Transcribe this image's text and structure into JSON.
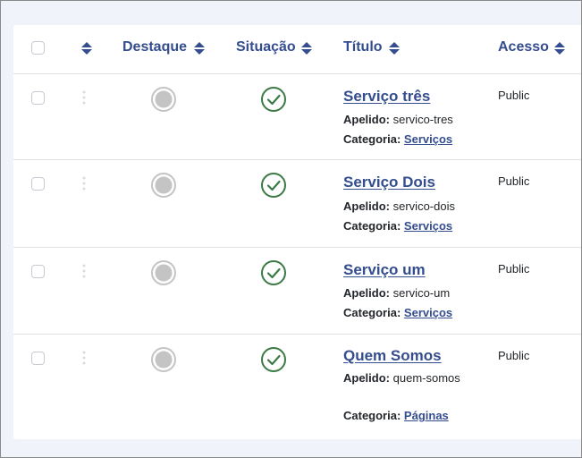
{
  "header": {
    "featured": "Destaque",
    "status": "Situação",
    "title": "Título",
    "access": "Acesso"
  },
  "labels": {
    "alias": "Apelido:",
    "category": "Categoria:"
  },
  "rows": [
    {
      "title": "Serviço três",
      "alias": "servico-tres",
      "category": "Serviços",
      "access": "Public"
    },
    {
      "title": "Serviço Dois",
      "alias": "servico-dois",
      "category": "Serviços",
      "access": "Public"
    },
    {
      "title": "Serviço um",
      "alias": "servico-um",
      "category": "Serviços",
      "access": "Public"
    },
    {
      "title": "Quem Somos",
      "alias": "quem-somos",
      "category": "Páginas",
      "access": "Public"
    }
  ],
  "colors": {
    "accent": "#344d8f",
    "published": "#3b7a45",
    "unfeatured": "#c4c4c4"
  },
  "icons": {
    "sort": "sort-icon",
    "drag": "drag-handle-icon",
    "featured": "unfeatured-circle-icon",
    "status": "published-check-icon"
  }
}
